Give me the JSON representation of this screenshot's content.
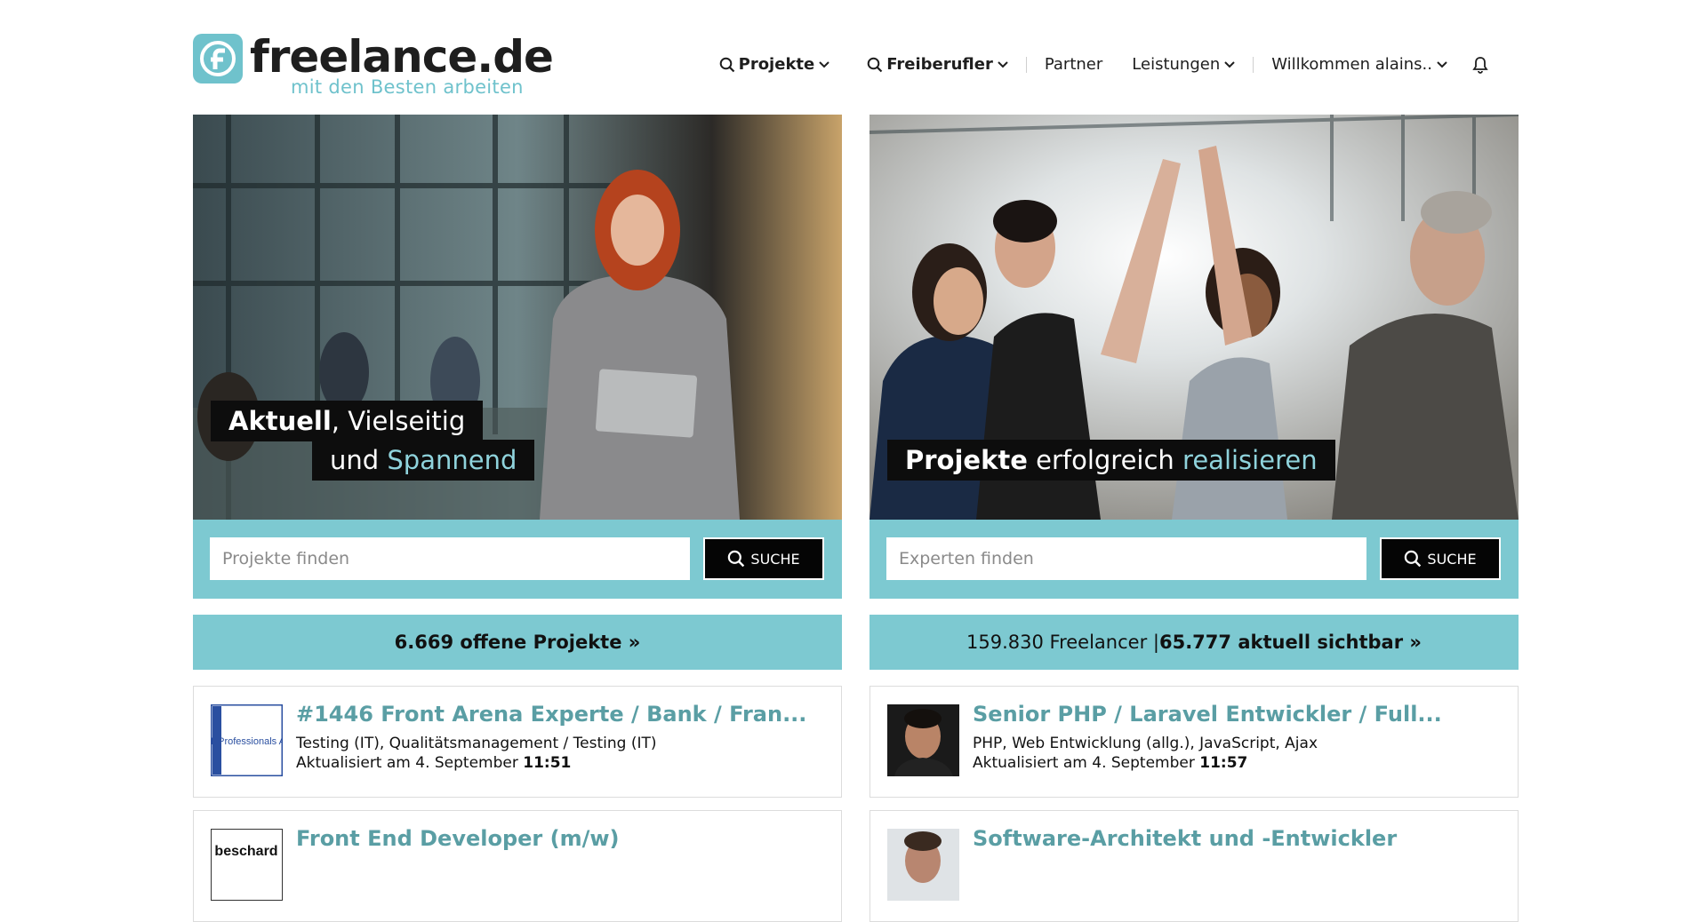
{
  "brand": {
    "name": "freelance.de",
    "tagline": "mit den Besten arbeiten"
  },
  "nav": {
    "projects": "Projekte",
    "freelancers": "Freiberufler",
    "partner": "Partner",
    "services": "Leistungen",
    "welcome": "Willkommen alains.."
  },
  "left": {
    "caption_line1_bold": "Aktuell",
    "caption_line1_rest": ", Vielseitig",
    "caption_line2_pre": "und ",
    "caption_line2_accent": "Spannend",
    "search_placeholder": "Projekte finden",
    "search_button": "SUCHE",
    "count_text": "6.669 offene Projekte »",
    "cards": [
      {
        "title": "#1446 Front Arena Experte / Bank / Fran...",
        "tags": "Testing (IT), Qualitätsmanagement / Testing (IT)",
        "date_prefix": "Aktualisiert am 4. September ",
        "time": "11:51",
        "logo_text": "IT Professionals AG"
      },
      {
        "title": "Front End Developer (m/w)",
        "logo_text": "beschard"
      }
    ]
  },
  "right": {
    "caption_bold": "Projekte",
    "caption_mid": " erfolgreich ",
    "caption_accent": "realisieren",
    "search_placeholder": "Experten finden",
    "search_button": "SUCHE",
    "count_prefix": "159.830 Freelancer | ",
    "count_bold": "65.777 aktuell sichtbar »",
    "cards": [
      {
        "title": "Senior PHP / Laravel Entwickler / Full...",
        "tags": "PHP, Web Entwicklung (allg.), JavaScript, Ajax",
        "date_prefix": "Aktualisiert am 4. September ",
        "time": "11:57"
      },
      {
        "title": "Software-Architekt und -Entwickler"
      }
    ]
  },
  "colors": {
    "accent": "#7dc9d1",
    "title": "#5a9ea4",
    "dark": "#0d0d0d"
  }
}
